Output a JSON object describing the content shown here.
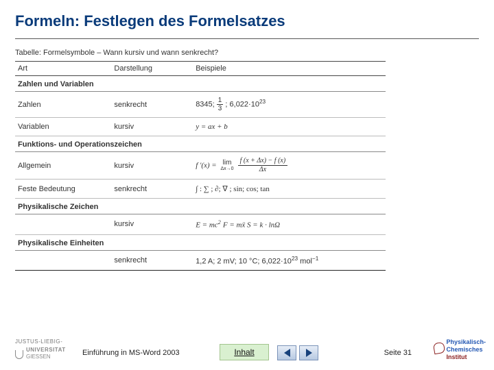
{
  "title": "Formeln: Festlegen des Formelsatzes",
  "table": {
    "caption": "Tabelle: Formelsymbole – Wann kursiv und wann senkrecht?",
    "headers": {
      "art": "Art",
      "dar": "Darstellung",
      "bsp": "Beispiele"
    },
    "section1": "Zahlen und Variablen",
    "row_zahlen": {
      "art": "Zahlen",
      "dar": "senkrecht",
      "bsp_pre": "8345; ",
      "frac_num": "1",
      "frac_den": "3",
      "bsp_post": "; 6,022·10",
      "exp": "23"
    },
    "row_var": {
      "art": "Variablen",
      "dar": "kursiv",
      "bsp": "y = ax + b"
    },
    "section2": "Funktions- und Operationszeichen",
    "row_allg": {
      "art": "Allgemein",
      "dar": "kursiv",
      "lhs": "f '(x) = ",
      "lim_top": "lim",
      "lim_bot": "Δx→0",
      "frac_num": "f (x + Δx) − f (x)",
      "frac_den": "Δx"
    },
    "row_feste": {
      "art": "Feste Bedeutung",
      "dar": "senkrecht",
      "bsp": "∫ : ∑ ; ∂; ∇ ; sin; cos; tan"
    },
    "section3": "Physikalische Zeichen",
    "row_phys": {
      "art": "",
      "dar": "kursiv",
      "eq1": "E = mc",
      "exp1": "2",
      "eq2": "   F = mẍ   S = k · lnΩ"
    },
    "section4": "Physikalische Einheiten",
    "row_units": {
      "art": "",
      "dar": "senkrecht",
      "bsp_pre": "1,2 A;    2 mV; 10 °C; 6,022·10",
      "exp": "23",
      "bsp_post": " mol",
      "exp2": "−1"
    }
  },
  "footer": {
    "logo_left": {
      "top": "JUSTUS-LIEBIG-",
      "uni": "UNIVERSITAT",
      "city": "GIESSEN"
    },
    "presentation": "Einführung in MS-Word 2003",
    "inhalt": "Inhalt",
    "page": "Seite 31",
    "logo_right": {
      "l1": "Physikalisch-",
      "l2": "Chemisches",
      "l3": "Institut"
    }
  }
}
